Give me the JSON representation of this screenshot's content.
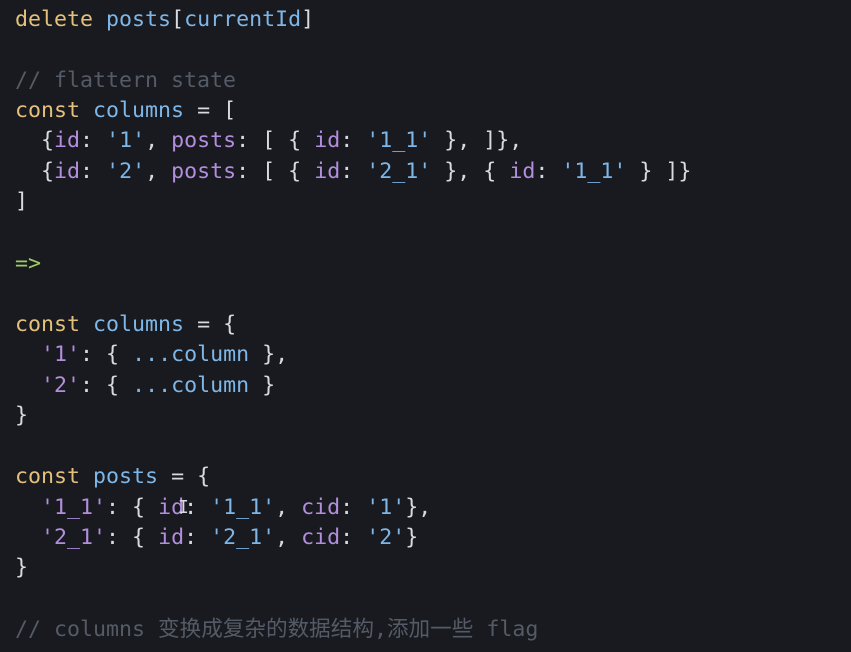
{
  "line1": {
    "kw": "delete",
    "var": "posts",
    "open": "[",
    "prop": "currentId",
    "close": "]"
  },
  "line3": {
    "comment": "// flattern state"
  },
  "line4": {
    "kw": "const",
    "var": "columns",
    "eq": "=",
    "open": "["
  },
  "line5": {
    "lead": "{",
    "k1": "id",
    "c1": ":",
    "s1": "'1'",
    "comma1": ",",
    "k2": "posts",
    "c2": ":",
    "open": "[ {",
    "k3": "id",
    "c3": ":",
    "s2": "'1_1'",
    "tail": "}, ]},"
  },
  "line6": {
    "lead": "{",
    "k1": "id",
    "c1": ":",
    "s1": "'2'",
    "comma1": ",",
    "k2": "posts",
    "c2": ":",
    "open": "[ {",
    "k3": "id",
    "c3": ":",
    "s2": "'2_1'",
    "mid": "}, {",
    "k4": "id",
    "c4": ":",
    "s3": "'1_1'",
    "tail": "} ]}"
  },
  "line7": {
    "text": "]"
  },
  "line9": {
    "arrow": "=>"
  },
  "line11": {
    "kw": "const",
    "var": "columns",
    "eq": "=",
    "open": "{"
  },
  "line12": {
    "key": "'1'",
    "mid": ": {",
    "spread": "...column",
    "tail": "},"
  },
  "line13": {
    "key": "'2'",
    "mid": ": {",
    "spread": "...column",
    "tail": "}"
  },
  "line14": {
    "text": "}"
  },
  "line16": {
    "kw": "const",
    "var": "posts",
    "eq": "=",
    "open": "{"
  },
  "line17": {
    "key": "'1_1'",
    "mid": ": {",
    "k1": "id",
    "c1": ":",
    "s1": "'1_1'",
    "comma": ",",
    "k2": "cid",
    "c2": ":",
    "s2": "'1'",
    "tail": "},"
  },
  "line18": {
    "key": "'2_1'",
    "mid": ": {",
    "k1": "id",
    "c1": ":",
    "s1": "'2_1'",
    "comma": ",",
    "k2": "cid",
    "c2": ":",
    "s2": "'2'",
    "tail": "}"
  },
  "line19": {
    "text": "}"
  },
  "line21": {
    "comment": "// columns 变换成复杂的数据结构,添加一些 flag"
  },
  "cursor": {
    "glyph": "I"
  }
}
